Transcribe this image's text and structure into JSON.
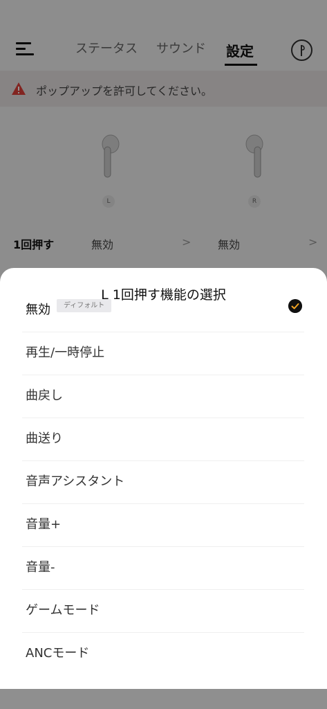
{
  "header": {
    "tabs": [
      {
        "label": "ステータス",
        "active": false
      },
      {
        "label": "サウンド",
        "active": false
      },
      {
        "label": "設定",
        "active": true
      }
    ],
    "menu_icon": "hamburger-menu-icon",
    "device_icon": "earbud-device-icon"
  },
  "banner": {
    "icon": "warning-icon",
    "text": "ポップアップを許可してください。",
    "icon_color": "#e0403a"
  },
  "earbuds": {
    "left_badge": "L",
    "right_badge": "R"
  },
  "settings_row": {
    "label": "1回押す",
    "left_value": "無効",
    "right_value": "無効",
    "chevron": ">"
  },
  "sheet": {
    "title": "L 1回押す機能の選択",
    "options": [
      {
        "label": "無効",
        "badge": "ディフォルト",
        "selected": true
      },
      {
        "label": "再生/一時停止"
      },
      {
        "label": "曲戻し"
      },
      {
        "label": "曲送り"
      },
      {
        "label": "音声アシスタント"
      },
      {
        "label": "音量+"
      },
      {
        "label": "音量-"
      },
      {
        "label": "ゲームモード"
      },
      {
        "label": "ANCモード"
      }
    ],
    "check_color": "#f5a623"
  }
}
